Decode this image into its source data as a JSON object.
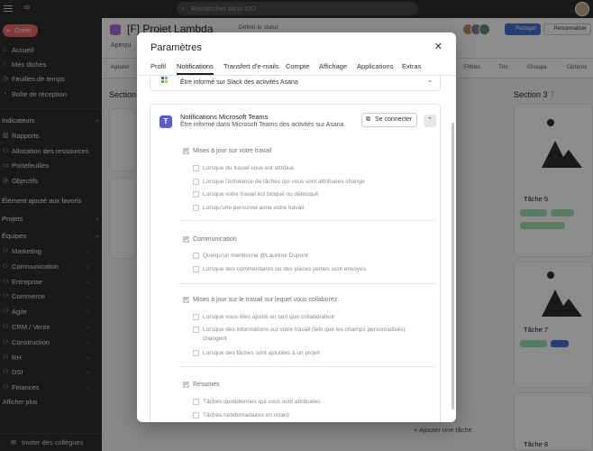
{
  "topbar": {
    "search_placeholder": "Rechercher dans iDO"
  },
  "sidebar": {
    "create_label": "Créer",
    "nav": [
      {
        "label": "Accueil",
        "icon": "home-icon"
      },
      {
        "label": "Mes tâches",
        "icon": "check-circle-icon"
      },
      {
        "label": "Feuilles de temps",
        "icon": "clock-icon"
      },
      {
        "label": "Boîte de réception",
        "icon": "bell-icon"
      }
    ],
    "indicators_title": "Indicateurs",
    "indicators": [
      {
        "label": "Rapports"
      },
      {
        "label": "Allocation des ressources"
      },
      {
        "label": "Portefeuilles"
      },
      {
        "label": "Objectifs"
      }
    ],
    "favorites_label": "Élément ajouté aux favoris",
    "projects_label": "Projets",
    "teams_label": "Équipes",
    "teams": [
      "Marketing",
      "Communication",
      "Entreprise",
      "Commerce",
      "Agile",
      "CRM / Vente",
      "Construction",
      "RH",
      "DSI",
      "Finances"
    ],
    "show_more": "Afficher plus",
    "invite_label": "Inviter des collègues"
  },
  "project": {
    "title": "[F] Projet Lambda",
    "status_label": "Définir le statut",
    "overview_tab": "Aperçu",
    "share_label": "Partager",
    "customize_label": "Personnaliser",
    "add_label": "Ajouter",
    "filters_label": "Filtres",
    "sort_label": "Tris",
    "group_label": "Groupe",
    "options_label": "Options",
    "section1": "Section 1",
    "section3": "Section 3",
    "section3_count": "7",
    "task5": "Tâche 5",
    "task7": "Tâche 7",
    "task8": "Tâche 8",
    "add_task": "Ajouter une tâche"
  },
  "modal": {
    "title": "Paramètres",
    "tabs": [
      "Profil",
      "Notifications",
      "Transfert d'e-mails",
      "Compte",
      "Affichage",
      "Applications",
      "Extras"
    ],
    "active_tab": "Notifications",
    "slack_desc": "Être informé sur Slack des activités Asana",
    "teams_title": "Notifications Microsoft Teams",
    "teams_desc": "Être informé dans Microsoft Teams des activités sur Asana",
    "connect_label": "Se connecter",
    "groups": [
      {
        "title": "Mises à jour sur votre travail",
        "items": [
          "Lorsque du travail vous est attribué",
          "Lorsque l'échéance de tâches qui vous sont attribuées change",
          "Lorsque votre travail est bloqué ou débloqué",
          "Lorsqu'une personne aime votre travail"
        ]
      },
      {
        "title": "Communication",
        "items": [
          "Quelqu'un mentionne @Laurène Dupont",
          "Lorsque des commentaires ou des pièces jointes sont envoyés"
        ]
      },
      {
        "title": "Mises à jour sur le travail sur lequel vous collaborez",
        "items": [
          "Lorsque vous êtes ajouté en tant que collaborateur",
          "Lorsque des informations sur votre travail (tels que les champs personnalisés) changent",
          "Lorsque des tâches sont ajoutées à un projet"
        ]
      },
      {
        "title": "Résumés",
        "items": [
          "Tâches quotidiennes qui vous sont attribuées",
          "Tâches hebdomadaires en retard"
        ]
      }
    ]
  }
}
